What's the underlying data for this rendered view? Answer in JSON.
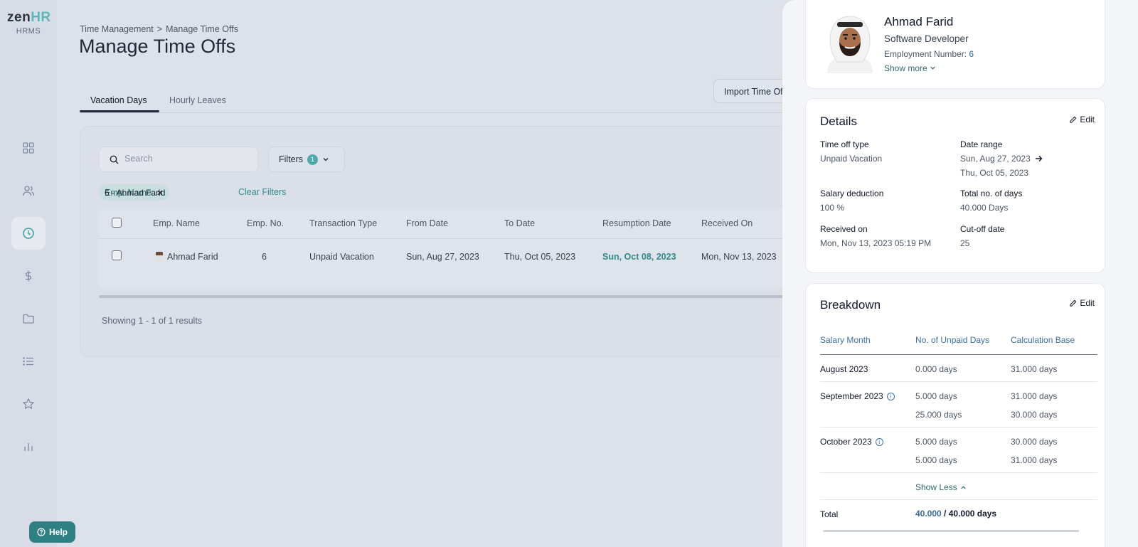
{
  "logo": {
    "main": "zen",
    "accent": "HR",
    "sub": "HRMS"
  },
  "help": {
    "label": "Help"
  },
  "breadcrumb": {
    "parent": "Time Management",
    "separator": ">",
    "current": "Manage Time Offs"
  },
  "page": {
    "title": "Manage Time Offs"
  },
  "tabs": [
    {
      "label": "Vacation Days",
      "active": true
    },
    {
      "label": "Hourly Leaves",
      "active": false
    }
  ],
  "import_button": {
    "label": "Import Time Offs"
  },
  "search": {
    "placeholder": "Search",
    "value": ""
  },
  "filters": {
    "label": "Filters",
    "count": "1"
  },
  "active_filter": {
    "key": "Emp. Name:",
    "value": "6 - Ahmad Farid"
  },
  "clear_filters": "Clear Filters",
  "table": {
    "headers": [
      "Emp. Name",
      "Emp. No.",
      "Transaction Type",
      "From Date",
      "To Date",
      "Resumption Date",
      "Received On"
    ],
    "rows": [
      {
        "name": "Ahmad Farid",
        "number": "6",
        "type": "Unpaid Vacation",
        "from": "Sun, Aug 27, 2023",
        "to": "Thu, Oct 05, 2023",
        "resumption": "Sun, Oct 08, 2023",
        "received": "Mon, Nov 13, 2023"
      }
    ]
  },
  "showing": "Showing 1 - 1 of 1 results",
  "profile": {
    "name": "Ahmad Farid",
    "role": "Software Developer",
    "emp_label": "Employment Number:",
    "emp_number": "6",
    "show_more": "Show more"
  },
  "details": {
    "title": "Details",
    "edit": "Edit",
    "time_off_type_label": "Time off type",
    "time_off_type": "Unpaid Vacation",
    "date_range_label": "Date range",
    "date_from": "Sun, Aug 27, 2023",
    "date_to": "Thu, Oct 05, 2023",
    "salary_deduction_label": "Salary deduction",
    "salary_deduction": "100 %",
    "total_days_label": "Total no. of days",
    "total_days": "40.000 Days",
    "received_on_label": "Received on",
    "received_on": "Mon, Nov 13, 2023 05:19 PM",
    "cutoff_label": "Cut-off date",
    "cutoff": "25"
  },
  "breakdown": {
    "title": "Breakdown",
    "edit": "Edit",
    "headers": [
      "Salary Month",
      "No. of Unpaid Days",
      "Calculation Base"
    ],
    "months": [
      {
        "month": "August 2023",
        "info": false,
        "lines": [
          {
            "days": "0.000 days",
            "base": "31.000 days"
          }
        ]
      },
      {
        "month": "September 2023",
        "info": true,
        "lines": [
          {
            "days": "5.000 days",
            "base": "31.000 days"
          },
          {
            "days": "25.000 days",
            "base": "30.000 days"
          }
        ]
      },
      {
        "month": "October 2023",
        "info": true,
        "lines": [
          {
            "days": "5.000 days",
            "base": "30.000 days"
          },
          {
            "days": "5.000 days",
            "base": "31.000 days"
          }
        ]
      }
    ],
    "show_less": "Show Less",
    "total_label": "Total",
    "total_unpaid": "40.000",
    "total_separator": " / ",
    "total_days": "40.000 days"
  },
  "colors": {
    "accent": "#2f8c8d",
    "link_blue": "#3d6ea3",
    "help_bg": "#2f8082"
  }
}
